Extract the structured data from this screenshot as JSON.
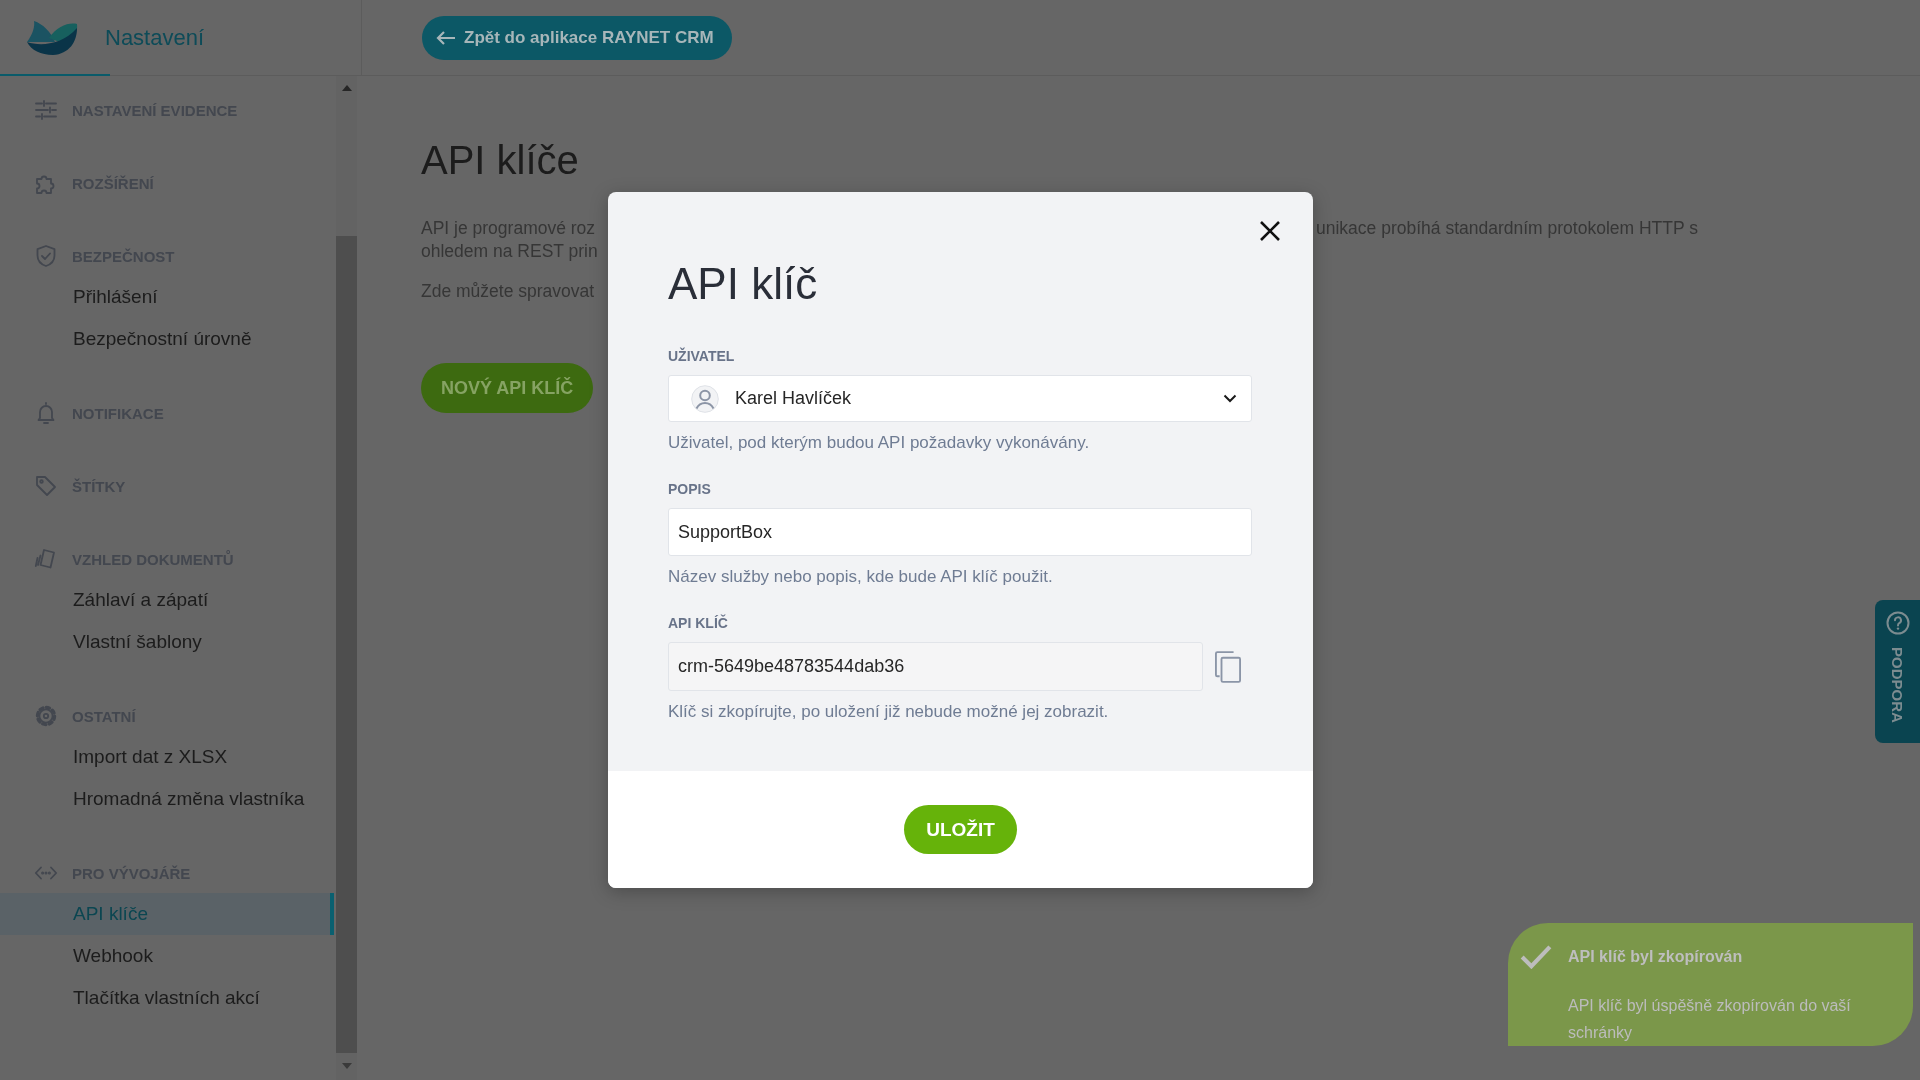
{
  "header": {
    "title": "Nastavení",
    "back_button": "Zpět do aplikace RAYNET CRM"
  },
  "sidebar": {
    "sections": [
      {
        "heading": "NASTAVENÍ EVIDENCE"
      },
      {
        "heading": "ROZŠÍŘENÍ"
      },
      {
        "heading": "BEZPEČNOST",
        "items": [
          {
            "label": "Přihlášení",
            "selected": false
          },
          {
            "label": "Bezpečnostní úrovně",
            "selected": false
          }
        ]
      },
      {
        "heading": "NOTIFIKACE"
      },
      {
        "heading": "ŠTÍTKY"
      },
      {
        "heading": "VZHLED DOKUMENTŮ",
        "items": [
          {
            "label": "Záhlaví a zápatí",
            "selected": false
          },
          {
            "label": "Vlastní šablony",
            "selected": false
          }
        ]
      },
      {
        "heading": "OSTATNÍ",
        "items": [
          {
            "label": "Import dat z XLSX",
            "selected": false
          },
          {
            "label": "Hromadná změna vlastníka",
            "selected": false
          }
        ]
      },
      {
        "heading": "PRO VÝVOJÁŘE",
        "items": [
          {
            "label": "API klíče",
            "selected": true
          },
          {
            "label": "Webhook",
            "selected": false
          },
          {
            "label": "Tlačítka vlastních akcí",
            "selected": false
          }
        ]
      }
    ]
  },
  "page": {
    "title": "API klíče",
    "description": [
      {
        "lines": [
          [
            "API je programové roz",
            "unikace probíhá standardním protokolem HTTP s"
          ],
          [
            "ohledem na REST prin"
          ]
        ]
      },
      {
        "lines": [
          [
            "Zde můžete spravovat"
          ]
        ]
      }
    ],
    "new_button": "NOVÝ API KLÍČ"
  },
  "modal": {
    "title": "API klíč",
    "fields": [
      {
        "kind": "select",
        "label": "UŽIVATEL",
        "value": "Karel Havlíček",
        "hint": "Uživatel, pod kterým budou API požadavky vykonávány."
      },
      {
        "kind": "text",
        "label": "POPIS",
        "value": "SupportBox",
        "hint": "Název služby nebo popis, kde bude API klíč použit."
      },
      {
        "kind": "copyable",
        "label": "API KLÍČ",
        "value": "crm-5649be48783544dab36",
        "hint": "Klíč si zkopírujte, po uložení již nebude možné jej zobrazit."
      }
    ],
    "save_button": "ULOŽIT"
  },
  "toast": {
    "title": "API klíč byl zkopírován",
    "message": "API klíč byl úspěšně zkopírován do vaší schránky"
  },
  "support_tab": {
    "label": "PODPORA"
  }
}
